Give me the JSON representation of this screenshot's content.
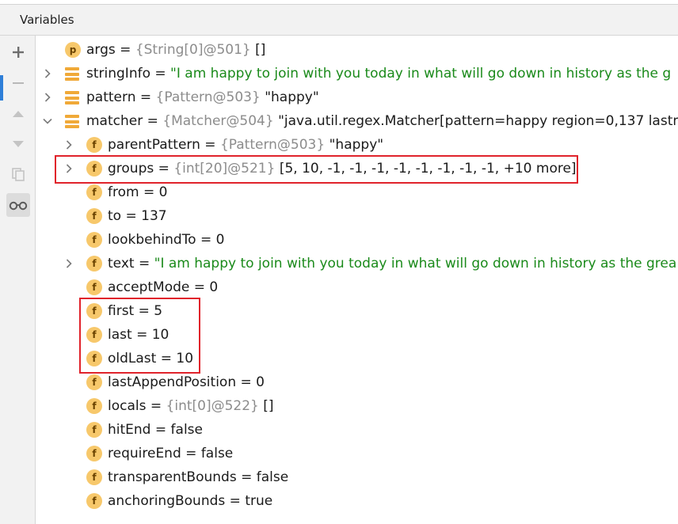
{
  "panel": {
    "title": "Variables"
  },
  "toolbar": {
    "icons": [
      "plus-icon",
      "minus-icon",
      "move-up-icon",
      "move-down-icon",
      "copy-icon",
      "glasses-icon"
    ]
  },
  "variables": [
    {
      "name": "args",
      "eq": " = ",
      "type": "{String[0]@501} ",
      "value": "[]",
      "value_style": "val",
      "kind": "p",
      "indent": 0,
      "expander": "none"
    },
    {
      "name": "stringInfo",
      "eq": " = ",
      "type": "",
      "value": "\"I am happy to join with you today in what will go down in history as the g",
      "value_style": "str",
      "kind": "stack",
      "indent": 0,
      "expander": "collapsed"
    },
    {
      "name": "pattern",
      "eq": " = ",
      "type": "{Pattern@503} ",
      "value": "\"happy\"",
      "value_style": "val",
      "kind": "stack",
      "indent": 0,
      "expander": "collapsed"
    },
    {
      "name": "matcher",
      "eq": " = ",
      "type": "{Matcher@504} ",
      "value": "\"java.util.regex.Matcher[pattern=happy region=0,137 lastm",
      "value_style": "val",
      "kind": "stack",
      "indent": 0,
      "expander": "expanded"
    },
    {
      "name": "parentPattern",
      "eq": " = ",
      "type": "{Pattern@503} ",
      "value": "\"happy\"",
      "value_style": "val",
      "kind": "f",
      "indent": 1,
      "expander": "collapsed"
    },
    {
      "name": "groups",
      "eq": " = ",
      "type": "{int[20]@521} ",
      "value": "[5, 10, -1, -1, -1, -1, -1, -1, -1, -1, +10 more]",
      "value_style": "val",
      "kind": "f",
      "indent": 1,
      "expander": "collapsed"
    },
    {
      "name": "from",
      "eq": " = ",
      "type": "",
      "value": "0",
      "value_style": "val",
      "kind": "f",
      "indent": 1,
      "expander": "none"
    },
    {
      "name": "to",
      "eq": " = ",
      "type": "",
      "value": "137",
      "value_style": "val",
      "kind": "f",
      "indent": 1,
      "expander": "none"
    },
    {
      "name": "lookbehindTo",
      "eq": " = ",
      "type": "",
      "value": "0",
      "value_style": "val",
      "kind": "f",
      "indent": 1,
      "expander": "none"
    },
    {
      "name": "text",
      "eq": " = ",
      "type": "",
      "value": "\"I am happy to join with you today in what will go down in history as the grea",
      "value_style": "str",
      "kind": "f",
      "indent": 1,
      "expander": "collapsed"
    },
    {
      "name": "acceptMode",
      "eq": " = ",
      "type": "",
      "value": "0",
      "value_style": "val",
      "kind": "f",
      "indent": 1,
      "expander": "none"
    },
    {
      "name": "first",
      "eq": " = ",
      "type": "",
      "value": "5",
      "value_style": "val",
      "kind": "f",
      "indent": 1,
      "expander": "none"
    },
    {
      "name": "last",
      "eq": " = ",
      "type": "",
      "value": "10",
      "value_style": "val",
      "kind": "f",
      "indent": 1,
      "expander": "none"
    },
    {
      "name": "oldLast",
      "eq": " = ",
      "type": "",
      "value": "10",
      "value_style": "val",
      "kind": "f",
      "indent": 1,
      "expander": "none"
    },
    {
      "name": "lastAppendPosition",
      "eq": " = ",
      "type": "",
      "value": "0",
      "value_style": "val",
      "kind": "f",
      "indent": 1,
      "expander": "none"
    },
    {
      "name": "locals",
      "eq": " = ",
      "type": "{int[0]@522} ",
      "value": "[]",
      "value_style": "val",
      "kind": "f",
      "indent": 1,
      "expander": "none"
    },
    {
      "name": "hitEnd",
      "eq": " = ",
      "type": "",
      "value": "false",
      "value_style": "val",
      "kind": "f",
      "indent": 1,
      "expander": "none"
    },
    {
      "name": "requireEnd",
      "eq": " = ",
      "type": "",
      "value": "false",
      "value_style": "val",
      "kind": "f",
      "indent": 1,
      "expander": "none"
    },
    {
      "name": "transparentBounds",
      "eq": " = ",
      "type": "",
      "value": "false",
      "value_style": "val",
      "kind": "f",
      "indent": 1,
      "expander": "none"
    },
    {
      "name": "anchoringBounds",
      "eq": " = ",
      "type": "",
      "value": "true",
      "value_style": "val",
      "kind": "f",
      "indent": 1,
      "expander": "none"
    }
  ],
  "badge_labels": {
    "p": "p",
    "f": "f"
  },
  "colors": {
    "string": "#1a8a1a",
    "type": "#8c8c8c",
    "highlight": "#e0232b",
    "badge": "#f7c86b",
    "stack": "#f0a938"
  }
}
